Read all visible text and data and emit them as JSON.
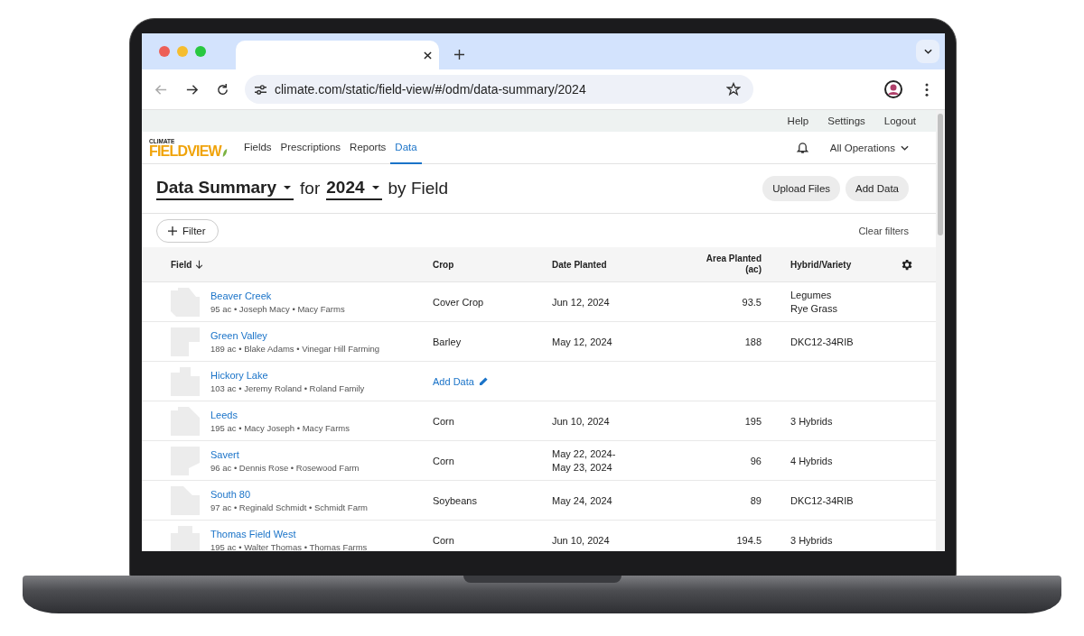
{
  "browser": {
    "url": "climate.com/static/field-view/#/odm/data-summary/2024"
  },
  "top_links": [
    "Help",
    "Settings",
    "Logout"
  ],
  "logo": {
    "small": "CLIMATE",
    "main": "FIELDVIEW"
  },
  "nav": [
    {
      "label": "Fields",
      "selected": false
    },
    {
      "label": "Prescriptions",
      "selected": false
    },
    {
      "label": "Reports",
      "selected": false
    },
    {
      "label": "Data",
      "selected": true
    }
  ],
  "operations": "All Operations",
  "title": {
    "report": "Data Summary",
    "joiner": "for",
    "year": "2024",
    "suffix": "by Field"
  },
  "buttons": [
    "Upload Files",
    "Add Data"
  ],
  "filter": {
    "label": "Filter",
    "clear": "Clear filters"
  },
  "columns": [
    {
      "label": "Field",
      "sorted": true
    },
    {
      "label": "Crop",
      "sorted": false
    },
    {
      "label": "Date Planted",
      "sorted": false
    },
    {
      "label": "Area Planted (ac)",
      "sorted": false
    },
    {
      "label": "Hybrid/Variety",
      "sorted": false
    }
  ],
  "rows": [
    {
      "kind": "data",
      "name": "Beaver Creek",
      "details": "95 ac • Joseph Macy • Macy Farms",
      "crop": "Cover Crop",
      "dates": [
        "Jun 12, 2024"
      ],
      "area": "93.5",
      "hybrids": [
        "Legumes",
        "Rye Grass"
      ]
    },
    {
      "kind": "data",
      "name": "Green Valley",
      "details": "189 ac • Blake Adams • Vinegar Hill Farming",
      "crop": "Barley",
      "dates": [
        "May 12, 2024"
      ],
      "area": "188",
      "hybrids": [
        "DKC12-34RIB"
      ]
    },
    {
      "kind": "missing",
      "name": "Hickory Lake",
      "details": "103 ac • Jeremy Roland • Roland Family",
      "action": "Add Data"
    },
    {
      "kind": "data",
      "name": "Leeds",
      "details": "195 ac • Macy Joseph • Macy Farms",
      "crop": "Corn",
      "dates": [
        "Jun 10, 2024"
      ],
      "area": "195",
      "hybrids": [
        "3 Hybrids"
      ]
    },
    {
      "kind": "data",
      "name": "Savert",
      "details": "96 ac • Dennis Rose • Rosewood Farm",
      "crop": "Corn",
      "dates": [
        "May 22, 2024-",
        "May 23, 2024"
      ],
      "area": "96",
      "hybrids": [
        "4 Hybrids"
      ]
    },
    {
      "kind": "data",
      "name": "South 80",
      "details": "97 ac • Reginald Schmidt • Schmidt Farm",
      "crop": "Soybeans",
      "dates": [
        "May 24, 2024"
      ],
      "area": "89",
      "hybrids": [
        "DKC12-34RIB"
      ]
    },
    {
      "kind": "data",
      "name": "Thomas Field West",
      "details": "195 ac • Walter Thomas • Thomas Farms",
      "crop": "Corn",
      "dates": [
        "Jun 10, 2024"
      ],
      "area": "194.5",
      "hybrids": [
        "3 Hybrids"
      ]
    }
  ]
}
